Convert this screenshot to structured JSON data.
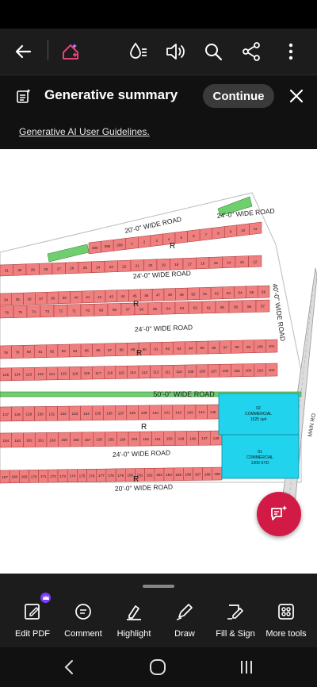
{
  "toolbar": {
    "icons": [
      "back-arrow-icon",
      "ai-assistant-icon",
      "liquid-mode-icon",
      "read-aloud-icon",
      "search-icon",
      "share-icon",
      "more-icon"
    ]
  },
  "summary": {
    "title": "Generative summary",
    "continue_label": "Continue",
    "guidelines_link": "Generative AI User Guidelines."
  },
  "document": {
    "roads": {
      "road_20_top": "20'-0\" WIDE ROAD",
      "road_24_top_right": "24'-0\" WIDE ROAD",
      "road_24_a": "24'-0\" WIDE ROAD",
      "road_24_b": "24'-0\" WIDE ROAD",
      "road_40_vertical": "40'-0\" WIDE ROAD",
      "road_50": "50'-0\" WIDE ROAD",
      "road_24_c": "24'-0\" WIDE ROAD",
      "road_20_bottom": "20'-0\" WIDE ROAD",
      "main_road": "MAIN RO"
    },
    "markers": [
      "R",
      "R",
      "R",
      "R",
      "R"
    ],
    "commercial": [
      {
        "number": "02",
        "label": "COMMERCIAL",
        "area": "1525 syd"
      },
      {
        "number": "01",
        "label": "COMMERCIAL",
        "area": "1200 SYD"
      }
    ],
    "rows": {
      "row1": [
        "300",
        "299",
        "298",
        "1",
        "2",
        "3",
        "4",
        "5",
        "6",
        "7",
        "8",
        "9",
        "10",
        "11"
      ],
      "row2": [
        "31",
        "30",
        "29",
        "28",
        "27",
        "26",
        "25",
        "24",
        "23",
        "22",
        "21",
        "20",
        "19",
        "18",
        "17",
        "16",
        "15",
        "14",
        "13",
        "12"
      ],
      "row3": [
        "34",
        "35",
        "36",
        "37",
        "38",
        "39",
        "40",
        "41",
        "42",
        "43",
        "44",
        "45",
        "46",
        "47",
        "48",
        "49",
        "50",
        "51",
        "52",
        "53",
        "54",
        "55",
        "56"
      ],
      "row4": [
        "76",
        "75",
        "74",
        "73",
        "72",
        "71",
        "70",
        "69",
        "68",
        "67",
        "66",
        "65",
        "64",
        "63",
        "62",
        "61",
        "60",
        "59",
        "58",
        "57"
      ],
      "row5": [
        "78",
        "79",
        "80",
        "81",
        "82",
        "83",
        "84",
        "85",
        "86",
        "87",
        "88",
        "89",
        "90",
        "91",
        "92",
        "93",
        "94",
        "95",
        "96",
        "97",
        "98",
        "99",
        "100",
        "101"
      ],
      "row6": [
        "125",
        "124",
        "123",
        "122",
        "121",
        "120",
        "119",
        "118",
        "117",
        "116",
        "115",
        "114",
        "113",
        "112",
        "111",
        "110",
        "109",
        "108",
        "107",
        "106",
        "105",
        "104",
        "103",
        "102"
      ],
      "row7": [
        "127",
        "128",
        "129",
        "130",
        "131",
        "132",
        "133",
        "134",
        "135",
        "136",
        "137",
        "138",
        "139",
        "140",
        "141",
        "142",
        "143",
        "144",
        "145"
      ],
      "row8": [
        "164",
        "163",
        "162",
        "161",
        "160",
        "159",
        "158",
        "157",
        "156",
        "155",
        "154",
        "153",
        "152",
        "151",
        "150",
        "149",
        "148",
        "147",
        "146"
      ],
      "row9": [
        "167",
        "168",
        "169",
        "170",
        "171",
        "172",
        "173",
        "174",
        "175",
        "176",
        "177",
        "178",
        "179",
        "180",
        "181",
        "182",
        "183",
        "184",
        "185",
        "186",
        "187",
        "188",
        "189"
      ]
    }
  },
  "bottom_tools": [
    {
      "label": "Edit PDF",
      "icon": "edit-pdf-icon"
    },
    {
      "label": "Comment",
      "icon": "comment-icon"
    },
    {
      "label": "Highlight",
      "icon": "highlight-icon"
    },
    {
      "label": "Draw",
      "icon": "draw-icon"
    },
    {
      "label": "Fill & Sign",
      "icon": "fill-sign-icon"
    },
    {
      "label": "More tools",
      "icon": "more-tools-icon"
    }
  ],
  "nav": {
    "icons": [
      "nav-back-icon",
      "nav-home-icon",
      "nav-recents-icon"
    ]
  },
  "colors": {
    "plot_fill": "#f08080",
    "plot_stroke": "#a03030",
    "green_strip": "#6fcf6f",
    "commercial": "#22d3ee",
    "fab": "#d11a45",
    "toolbar_bg": "#1c1c1c"
  }
}
